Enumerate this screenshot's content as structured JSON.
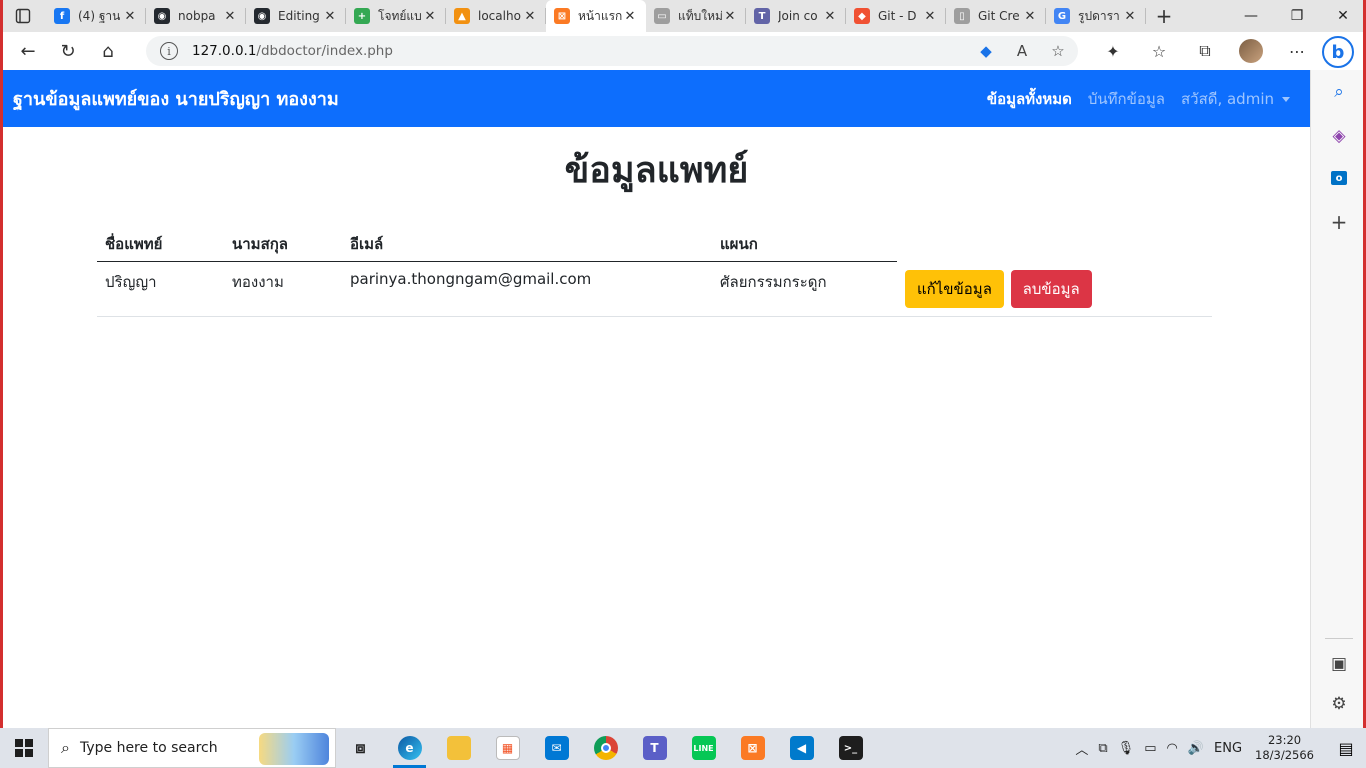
{
  "browser": {
    "tabs": [
      {
        "title": "(4) ฐาน",
        "favicon_color": "#1877f2",
        "favicon_glyph": "f",
        "active": false
      },
      {
        "title": "nobpa",
        "favicon_color": "#24292f",
        "favicon_glyph": "◉",
        "active": false
      },
      {
        "title": "Editing",
        "favicon_color": "#24292f",
        "favicon_glyph": "◉",
        "active": false
      },
      {
        "title": "โจทย์แบ",
        "favicon_color": "#34a853",
        "favicon_glyph": "+",
        "active": false
      },
      {
        "title": "localho",
        "favicon_color": "#f29111",
        "favicon_glyph": "▲",
        "active": false
      },
      {
        "title": "หน้าแรก",
        "favicon_color": "#fb7a24",
        "favicon_glyph": "⊠",
        "active": true
      },
      {
        "title": "แท็บใหม่",
        "favicon_color": "#9e9e9e",
        "favicon_glyph": "▭",
        "active": false
      },
      {
        "title": "Join co",
        "favicon_color": "#6264a7",
        "favicon_glyph": "T",
        "active": false
      },
      {
        "title": "Git - D",
        "favicon_color": "#f05133",
        "favicon_glyph": "◆",
        "active": false
      },
      {
        "title": "Git Cre",
        "favicon_color": "#9e9e9e",
        "favicon_glyph": "▯",
        "active": false
      },
      {
        "title": "รูปดารา",
        "favicon_color": "#4285f4",
        "favicon_glyph": "G",
        "active": false
      }
    ],
    "url_host": "127.0.0.1",
    "url_path": "/dbdoctor/index.php"
  },
  "site": {
    "brand": "ฐานข้อมูลแพทย์ของ นายปริญญา ทองงาม",
    "nav": {
      "all": "ข้อมูลทั้งหมด",
      "record": "บันทึกข้อมูล",
      "user": "สวัสดี, admin"
    },
    "title": "ข้อมูลแพทย์",
    "table": {
      "headers": [
        "ชื่อแพทย์",
        "นามสกุล",
        "อีเมล์",
        "แผนก"
      ],
      "rows": [
        {
          "firstname": "ปริญญา",
          "lastname": "ทองงาม",
          "email": "parinya.thongngam@gmail.com",
          "department": "ศัลยกรรมกระดูก",
          "edit_label": "แก้ไขข้อมูล",
          "delete_label": "ลบข้อมูล"
        }
      ]
    }
  },
  "taskbar": {
    "search_placeholder": "Type here to search",
    "language": "ENG",
    "time": "23:20",
    "date": "18/3/2566"
  }
}
